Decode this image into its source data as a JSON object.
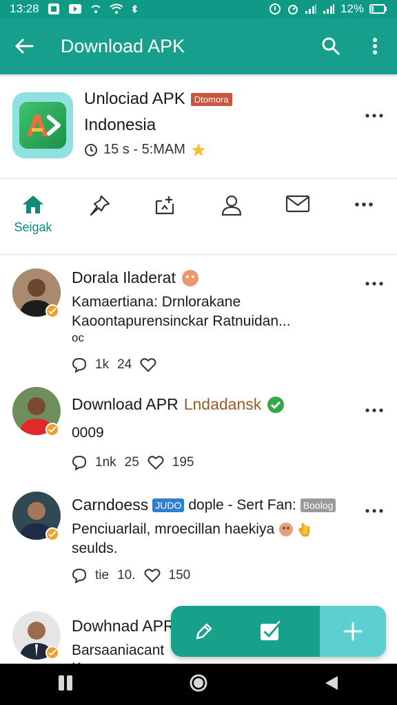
{
  "status_bar": {
    "time": "13:28",
    "battery": "12%"
  },
  "app_bar": {
    "title": "Download APK"
  },
  "app_header": {
    "name": "Unlociad APK",
    "badge": "Dtomora",
    "country": "Indonesia",
    "meta": "15 s  - 5:MAM"
  },
  "tabs": [
    {
      "label": "Seigak",
      "icon": "home-icon"
    },
    {
      "label": "",
      "icon": "pin-icon"
    },
    {
      "label": "",
      "icon": "add-post-icon"
    },
    {
      "label": "",
      "icon": "profile-icon"
    },
    {
      "label": "",
      "icon": "mail-icon"
    },
    {
      "label": "",
      "icon": "more-icon"
    }
  ],
  "posts": [
    {
      "author": "Dorala Iladerat",
      "line1": "Kamaertiana: Drnlorakane",
      "line2": "Kaoontapurensinckar Ratnuidan...",
      "line3": "oc",
      "comments": "1k",
      "likes": "24",
      "hearts": ""
    },
    {
      "author": "Download APR",
      "author_suffix": "Lndadansk",
      "line1": "0009",
      "comments": "1nk",
      "likes": "25",
      "hearts": "195"
    },
    {
      "author": "Carndoess",
      "tag1": "JUDO",
      "author_mid": "dople - Sert Fan:",
      "tag2": "Boolog",
      "line1": "Penciuarlail, mroecillan haekiya",
      "line2": "seulds.",
      "comments": "tie",
      "likes": "10.",
      "hearts": "150"
    },
    {
      "author": "Dowhnad APR",
      "line1": "Barsaaniacant",
      "line2": "Kau..."
    }
  ],
  "colors": {
    "primary": "#16a08b",
    "accent": "#5ccfd1",
    "badge": "#c8553d"
  }
}
